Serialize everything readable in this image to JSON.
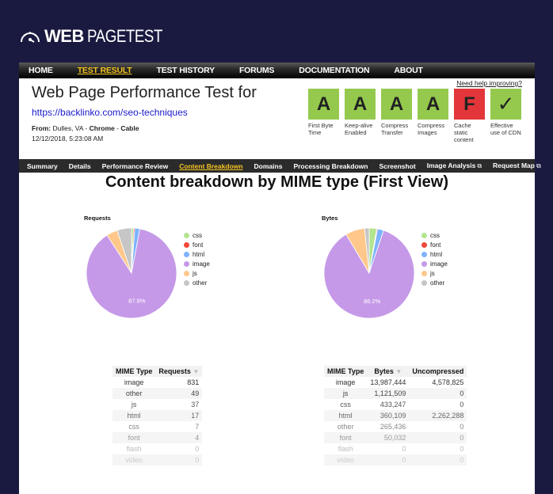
{
  "logo": {
    "bold": "WEB",
    "light": "PAGETEST",
    "icon": "speedometer-icon"
  },
  "topnav": [
    {
      "label": "HOME",
      "active": false
    },
    {
      "label": "TEST RESULT",
      "active": true
    },
    {
      "label": "TEST HISTORY",
      "active": false
    },
    {
      "label": "FORUMS",
      "active": false
    },
    {
      "label": "DOCUMENTATION",
      "active": false
    },
    {
      "label": "ABOUT",
      "active": false
    }
  ],
  "header": {
    "title": "Web Page Performance Test for",
    "url": "https://backlinko.com/seo-techniques",
    "from_label": "From:",
    "location": "Dulles, VA",
    "browser": "Chrome",
    "connection": "Cable",
    "date": "12/12/2018, 5:23:08 AM",
    "help_link": "Need help improving?"
  },
  "grades": [
    {
      "grade": "A",
      "label1": "First Byte",
      "label2": "Time",
      "label3": "",
      "color": "#95c94e"
    },
    {
      "grade": "A",
      "label1": "Keep-alive",
      "label2": "Enabled",
      "label3": "",
      "color": "#95c94e"
    },
    {
      "grade": "A",
      "label1": "Compress",
      "label2": "Transfer",
      "label3": "",
      "color": "#95c94e"
    },
    {
      "grade": "A",
      "label1": "Compress",
      "label2": "Images",
      "label3": "",
      "color": "#95c94e"
    },
    {
      "grade": "F",
      "label1": "Cache",
      "label2": "static",
      "label3": "content",
      "color": "#e2363a"
    },
    {
      "grade": "✓",
      "label1": "Effective",
      "label2": "use of CDN",
      "label3": "",
      "color": "#95c94e"
    }
  ],
  "subnav": [
    {
      "label": "Summary",
      "active": false,
      "external": false
    },
    {
      "label": "Details",
      "active": false,
      "external": false
    },
    {
      "label": "Performance Review",
      "active": false,
      "external": false
    },
    {
      "label": "Content Breakdown",
      "active": true,
      "external": false
    },
    {
      "label": "Domains",
      "active": false,
      "external": false
    },
    {
      "label": "Processing Breakdown",
      "active": false,
      "external": false
    },
    {
      "label": "Screenshot",
      "active": false,
      "external": false
    },
    {
      "label": "Image Analysis",
      "active": false,
      "external": true
    },
    {
      "label": "Request Map",
      "active": false,
      "external": true
    }
  ],
  "main_title": "Content breakdown by MIME type (First View)",
  "legend_colors": {
    "css": "#b3e58f",
    "font": "#f2463a",
    "html": "#7db3ff",
    "image": "#c599e8",
    "js": "#ffc78a",
    "other": "#c6c6c6"
  },
  "chart_data": [
    {
      "type": "pie",
      "title": "Requests",
      "labels": [
        "css",
        "font",
        "html",
        "image",
        "js",
        "other"
      ],
      "values": [
        7,
        4,
        17,
        831,
        37,
        49
      ],
      "slice_label": "87.9%",
      "legend": "right"
    },
    {
      "type": "pie",
      "title": "Bytes",
      "labels": [
        "css",
        "font",
        "html",
        "image",
        "js",
        "other"
      ],
      "values": [
        433247,
        50032,
        360109,
        13987444,
        1121509,
        265436
      ],
      "slice_label": "86.2%",
      "legend": "right"
    }
  ],
  "requests_table": {
    "headers": [
      "MIME Type",
      "Requests"
    ],
    "rows": [
      [
        "image",
        "831"
      ],
      [
        "other",
        "49"
      ],
      [
        "js",
        "37"
      ],
      [
        "html",
        "17"
      ],
      [
        "css",
        "7"
      ],
      [
        "font",
        "4"
      ],
      [
        "flash",
        "0"
      ],
      [
        "video",
        "0"
      ]
    ]
  },
  "bytes_table": {
    "headers": [
      "MIME Type",
      "Bytes",
      "Uncompressed"
    ],
    "rows": [
      [
        "image",
        "13,987,444",
        "4,578,825"
      ],
      [
        "js",
        "1,121,509",
        "0"
      ],
      [
        "css",
        "433,247",
        "0"
      ],
      [
        "html",
        "360,109",
        "2,262,288"
      ],
      [
        "other",
        "265,436",
        "0"
      ],
      [
        "font",
        "50,032",
        "0"
      ],
      [
        "flash",
        "0",
        "0"
      ],
      [
        "video",
        "0",
        "0"
      ]
    ]
  }
}
